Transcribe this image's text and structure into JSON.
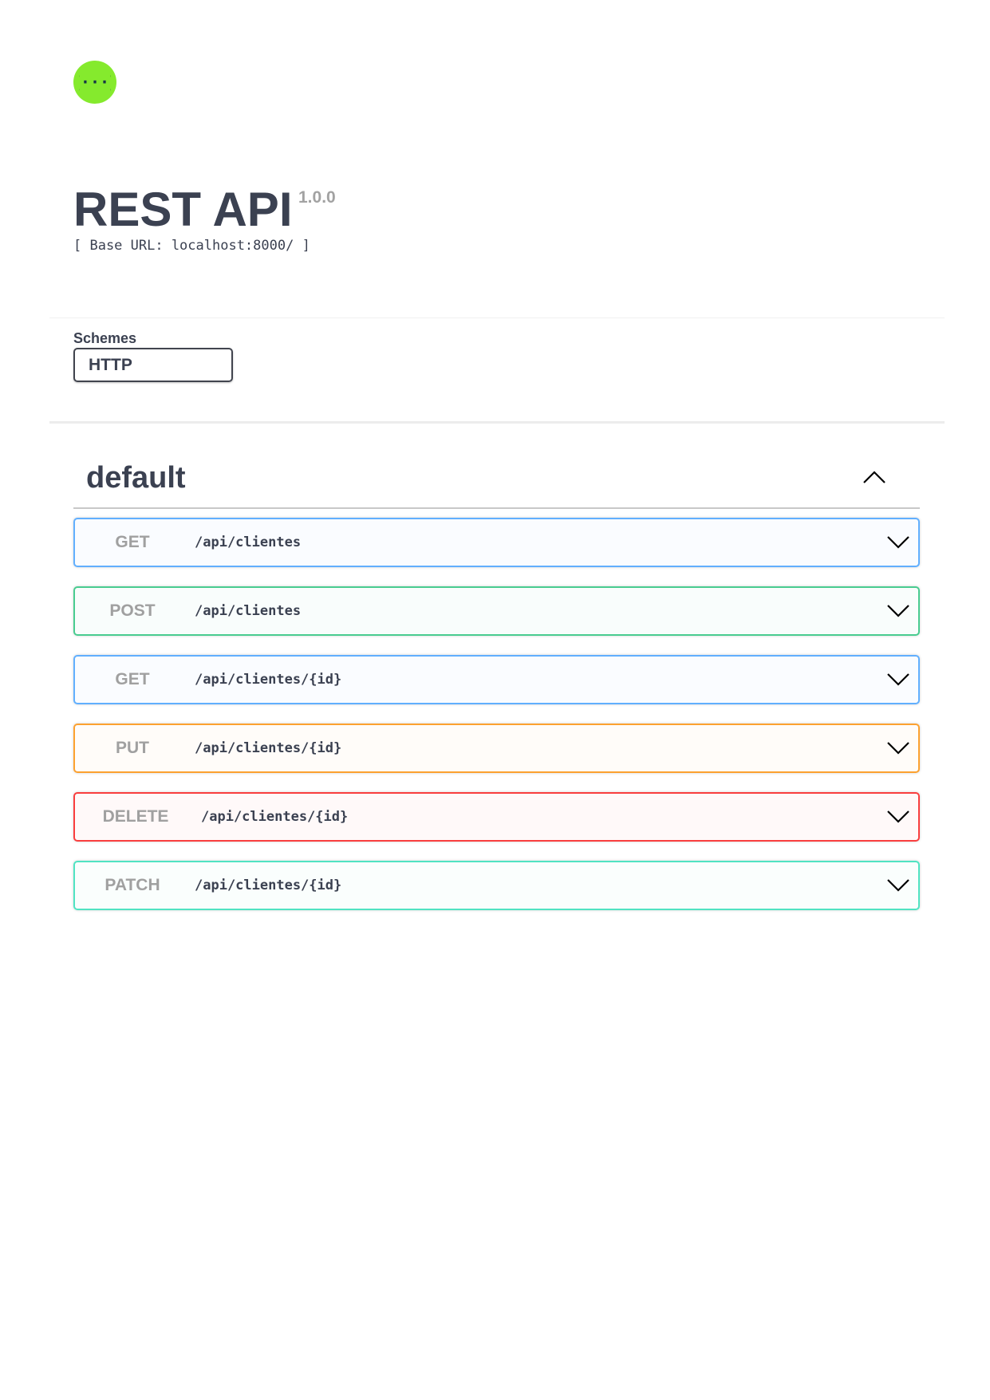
{
  "header": {
    "logo_icon": "swagger-braces-icon",
    "logo_color": "#85ea2d",
    "title": "REST API",
    "version": "1.0.0",
    "base_url": "[ Base URL: localhost:8000/ ]"
  },
  "schemes": {
    "label": "Schemes",
    "selected": "HTTP"
  },
  "section": {
    "title": "default",
    "collapse_icon": "chevron-up-icon"
  },
  "operations": [
    {
      "method": "GET",
      "path": "/api/clientes",
      "color": "#61affe"
    },
    {
      "method": "POST",
      "path": "/api/clientes",
      "color": "#49cc90"
    },
    {
      "method": "GET",
      "path": "/api/clientes/{id}",
      "color": "#61affe"
    },
    {
      "method": "PUT",
      "path": "/api/clientes/{id}",
      "color": "#fca130"
    },
    {
      "method": "DELETE",
      "path": "/api/clientes/{id}",
      "color": "#f93e3e"
    },
    {
      "method": "PATCH",
      "path": "/api/clientes/{id}",
      "color": "#50e3c2"
    }
  ]
}
